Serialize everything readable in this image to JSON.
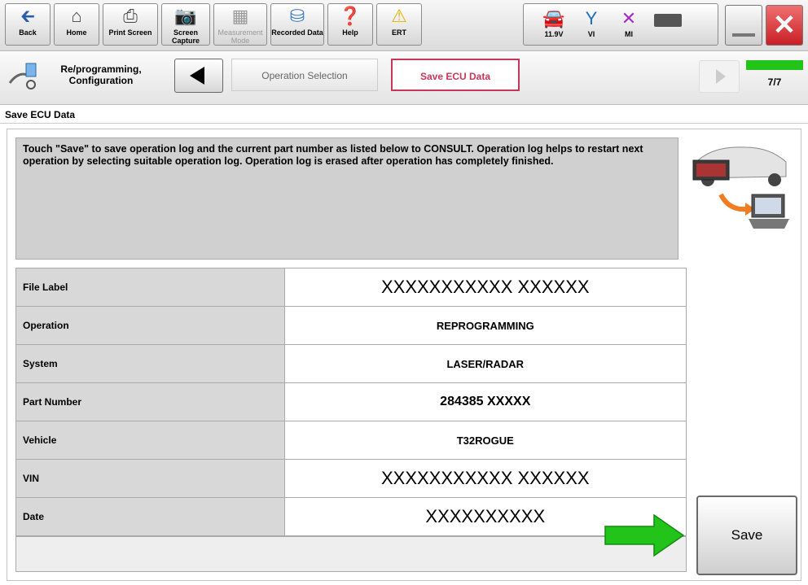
{
  "toolbar": {
    "back": "Back",
    "home": "Home",
    "print_screen": "Print Screen",
    "screen_capture": "Screen Capture",
    "measurement_mode": "Measurement Mode",
    "recorded_data": "Recorded Data",
    "help": "Help",
    "ert": "ERT",
    "voltage": "11.9V",
    "vi": "VI",
    "mi": "MI"
  },
  "nav": {
    "section": "Re/programming, Configuration",
    "step_operation_selection": "Operation Selection",
    "step_save_ecu_data": "Save ECU Data",
    "progress": "7/7"
  },
  "page": {
    "title": "Save ECU Data"
  },
  "message": "Touch \"Save\" to save operation log and the current part number as listed below to CONSULT. Operation log helps to restart next operation by selecting suitable operation log. Operation log is erased after operation has completely finished.",
  "rows": [
    {
      "label": "File Label",
      "value": "XXXXXXXXXXX XXXXXX"
    },
    {
      "label": "Operation",
      "value": "REPROGRAMMING"
    },
    {
      "label": "System",
      "value": "LASER/RADAR"
    },
    {
      "label": "Part Number",
      "value": "284385 XXXXX"
    },
    {
      "label": "Vehicle",
      "value": "T32ROGUE"
    },
    {
      "label": "VIN",
      "value": "XXXXXXXXXXX XXXXXX"
    },
    {
      "label": "Date",
      "value": "XXXXXXXXXX"
    }
  ],
  "save_button": "Save",
  "colors": {
    "arrow": "#22c41a",
    "progress": "#22c41a",
    "close_red": "#d9262c",
    "active_step_border": "#c8375a"
  }
}
